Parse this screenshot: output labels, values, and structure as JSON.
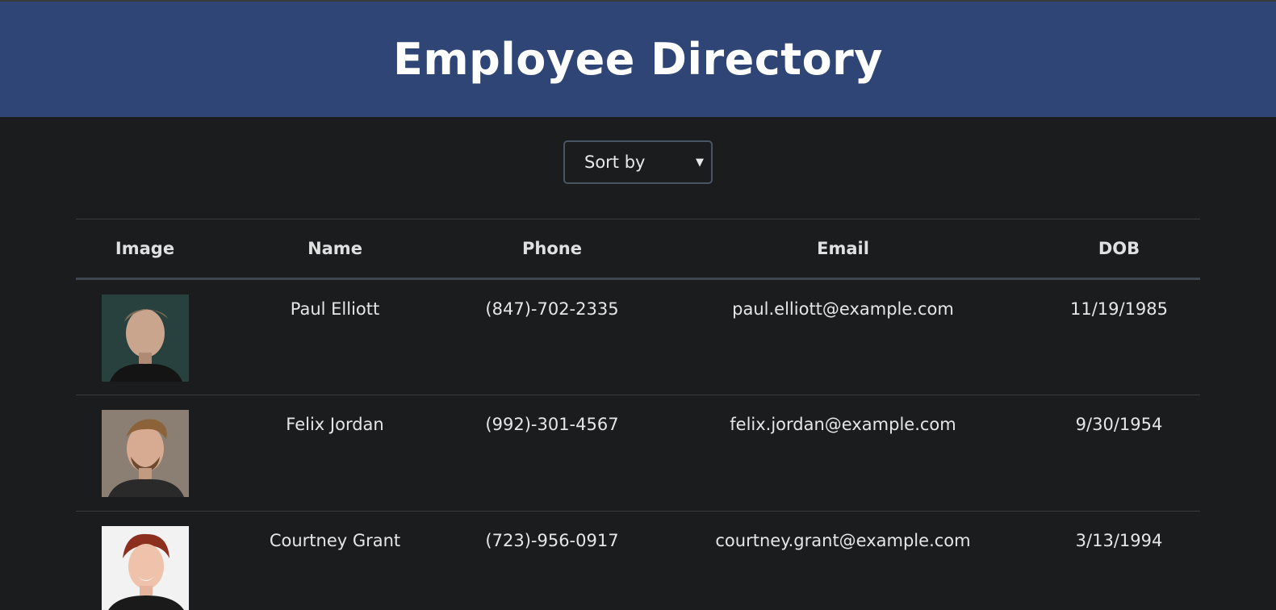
{
  "header": {
    "title": "Employee Directory"
  },
  "sort": {
    "label": "Sort by",
    "caret": "▼"
  },
  "table": {
    "columns": [
      "Image",
      "Name",
      "Phone",
      "Email",
      "DOB"
    ],
    "rows": [
      {
        "avatar_icon": "person-photo-icon",
        "name": "Paul Elliott",
        "phone": "(847)-702-2335",
        "email": "paul.elliott@example.com",
        "dob": "11/19/1985"
      },
      {
        "avatar_icon": "person-photo-icon",
        "name": "Felix Jordan",
        "phone": "(992)-301-4567",
        "email": "felix.jordan@example.com",
        "dob": "9/30/1954"
      },
      {
        "avatar_icon": "person-photo-icon",
        "name": "Courtney Grant",
        "phone": "(723)-956-0917",
        "email": "courtney.grant@example.com",
        "dob": "3/13/1994"
      }
    ]
  },
  "colors": {
    "header_bg": "#2e4575",
    "page_bg": "#1b1c1e"
  }
}
